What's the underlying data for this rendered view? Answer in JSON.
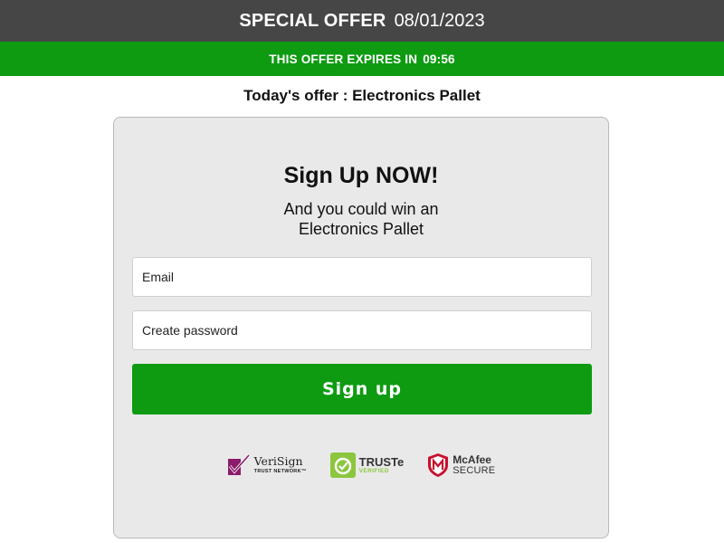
{
  "header": {
    "title": "SPECIAL OFFER",
    "date": "08/01/2023"
  },
  "expiry_bar": {
    "text": "THIS OFFER EXPIRES IN",
    "timer": "09:56"
  },
  "offer_line": "Today's offer : Electronics Pallet",
  "form": {
    "headline": "Sign Up NOW!",
    "subline_1": "And you could win an",
    "subline_2": "Electronics Pallet",
    "email_placeholder": "Email",
    "password_placeholder": "Create password",
    "submit_label": "Sign up"
  },
  "badges": {
    "verisign": {
      "name": "VeriSign",
      "sub": "TRUST NETWORK™",
      "icon": "verisign-check-icon"
    },
    "truste": {
      "name": "TRUSTe",
      "sub": "VERIFIED",
      "icon": "truste-seal-icon"
    },
    "mcafee": {
      "name": "McAfee",
      "sub": "SECURE",
      "icon": "mcafee-shield-icon"
    }
  },
  "colors": {
    "header_bg": "#464646",
    "accent_green": "#0e9b12",
    "card_bg": "#e9e9e9",
    "verisign_purple": "#8b1b6b",
    "truste_green": "#8cc63f",
    "mcafee_red": "#c8102e"
  }
}
